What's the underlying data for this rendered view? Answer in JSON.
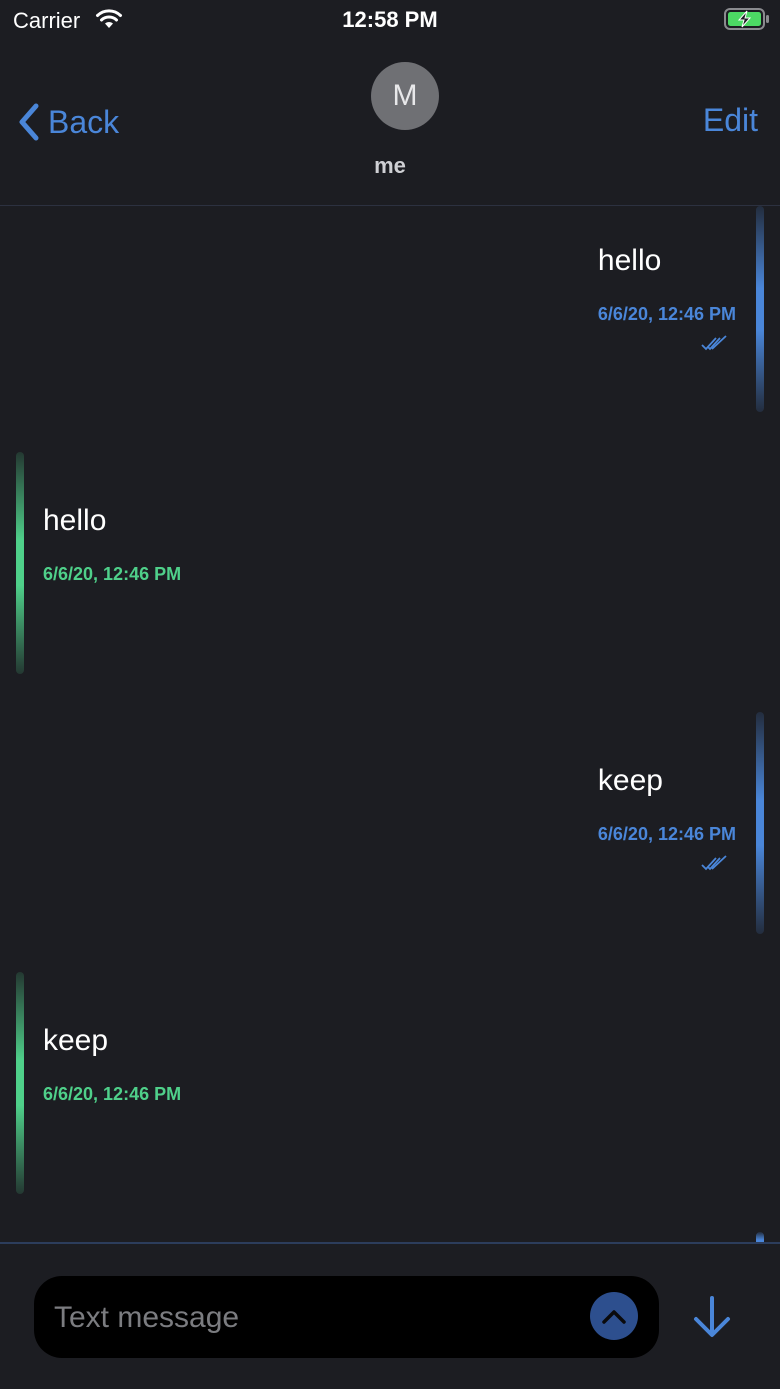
{
  "status_bar": {
    "carrier": "Carrier",
    "time": "12:58 PM"
  },
  "nav": {
    "back_label": "Back",
    "edit_label": "Edit",
    "avatar_initial": "M",
    "contact_name": "me"
  },
  "messages": [
    {
      "direction": "outgoing",
      "text": "hello",
      "time": "6/6/20, 12:46 PM",
      "read": true
    },
    {
      "direction": "incoming",
      "text": "hello",
      "time": "6/6/20, 12:46 PM"
    },
    {
      "direction": "outgoing",
      "text": "keep",
      "time": "6/6/20, 12:46 PM",
      "read": true
    },
    {
      "direction": "incoming",
      "text": "keep",
      "time": "6/6/20, 12:46 PM"
    }
  ],
  "composer": {
    "placeholder": "Text message",
    "value": ""
  },
  "colors": {
    "background": "#1c1d22",
    "accent_blue": "#4a86d9",
    "accent_green": "#4fd08a"
  },
  "icons": {
    "back": "chevron-left-icon",
    "wifi": "wifi-icon",
    "battery": "battery-charging-icon",
    "read_receipt": "double-check-icon",
    "expand": "chevron-up-icon",
    "scroll_down": "arrow-down-icon"
  }
}
